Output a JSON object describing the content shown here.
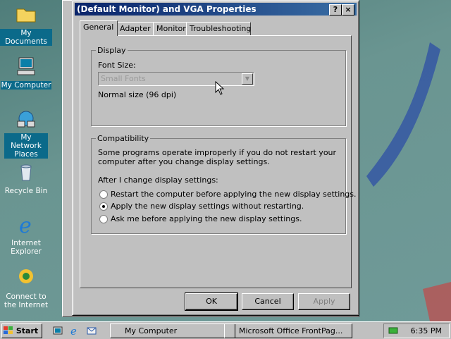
{
  "desktop": {
    "icons": [
      {
        "label": "My Documents"
      },
      {
        "label": "My Computer"
      },
      {
        "label": "My Network Places"
      },
      {
        "label": "Recycle Bin"
      },
      {
        "label": "Internet Explorer"
      },
      {
        "label": "Connect to the Internet"
      }
    ],
    "background_color": "#5d8a86"
  },
  "dialog": {
    "title": "(Default Monitor) and VGA Properties",
    "help_button": "?",
    "close_button": "×",
    "tabs": [
      {
        "label": "General"
      },
      {
        "label": "Adapter"
      },
      {
        "label": "Monitor"
      },
      {
        "label": "Troubleshooting"
      }
    ],
    "display_group": {
      "title": "Display",
      "font_size_label": "Font Size:",
      "font_size_value": "Small Fonts",
      "dpi_text": "Normal size (96 dpi)"
    },
    "compatibility_group": {
      "title": "Compatibility",
      "description_line1": "Some programs operate improperly if you do not restart your",
      "description_line2": "computer after you change display settings.",
      "after_change_label": "After I change display settings:",
      "options": [
        {
          "label": "Restart the computer before applying the new display settings.",
          "selected": false
        },
        {
          "label": "Apply the new display settings without restarting.",
          "selected": true
        },
        {
          "label": "Ask me before applying the new display settings.",
          "selected": false
        }
      ]
    },
    "buttons": {
      "ok": "OK",
      "cancel": "Cancel",
      "apply": "Apply"
    }
  },
  "taskbar": {
    "start_label": "Start",
    "tasks": [
      {
        "label": "My Computer"
      },
      {
        "label": "Microsoft Office FrontPag..."
      }
    ],
    "clock": "6:35 PM"
  },
  "colors": {
    "title_active": "#0a246a",
    "face": "#c0c0c0"
  }
}
